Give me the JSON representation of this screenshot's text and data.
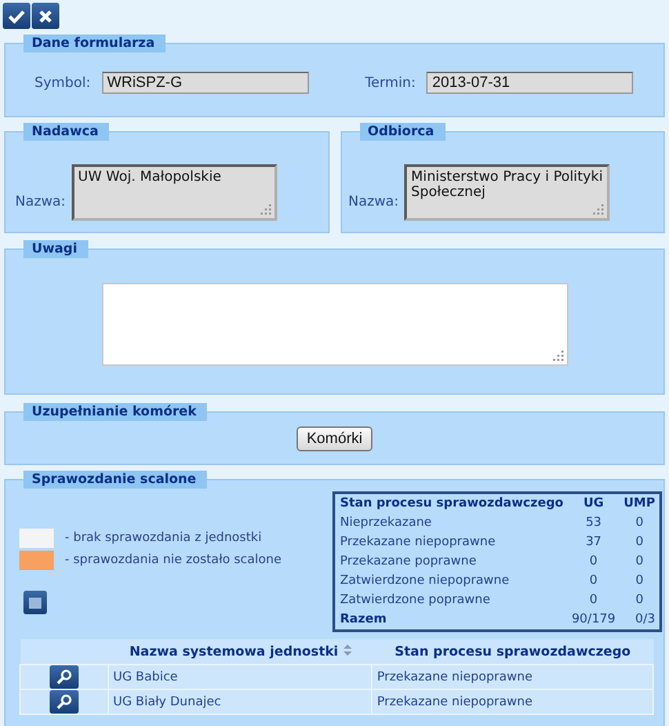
{
  "toolbar": {
    "buttons": [
      {
        "kind": "confirm"
      },
      {
        "kind": "cancel"
      }
    ]
  },
  "form_data": {
    "legend": "Dane formularza",
    "symbol_label": "Symbol:",
    "symbol_value": "WRiSPZ-G",
    "deadline_label": "Termin:",
    "deadline_value": "2013-07-31"
  },
  "sender": {
    "legend": "Nadawca",
    "name_label": "Nazwa:",
    "name_value": "UW Woj. Małopolskie"
  },
  "recipient": {
    "legend": "Odbiorca",
    "name_label": "Nazwa:",
    "name_value": "Ministerstwo Pracy i Polityki Społecznej"
  },
  "remarks": {
    "legend": "Uwagi"
  },
  "cells": {
    "legend": "Uzupełnianie komórek",
    "button": "Komórki"
  },
  "merged_report": {
    "legend": "Sprawozdanie scalone",
    "legend_items": [
      {
        "color": "#f4f4f4",
        "label": "- brak sprawozdania z jednostki"
      },
      {
        "color": "#f8a060",
        "label": "- sprawozdania nie zostało scalone"
      }
    ],
    "summary": {
      "columns": [
        "Stan procesu sprawozdawczego",
        "UG",
        "UMP"
      ],
      "rows": [
        [
          "Nieprzekazane",
          "53",
          "0"
        ],
        [
          "Przekazane niepoprawne",
          "37",
          "0"
        ],
        [
          "Przekazane poprawne",
          "0",
          "0"
        ],
        [
          "Zatwierdzone niepoprawne",
          "0",
          "0"
        ],
        [
          "Zatwierdzone poprawne",
          "0",
          "0"
        ]
      ],
      "total": [
        "Razem",
        "90/179",
        "0/3"
      ]
    },
    "table": {
      "columns": [
        "Nazwa systemowa jednostki",
        "Stan procesu sprawozdawczego"
      ],
      "rows": [
        [
          "UG Babice",
          "Przekazane niepoprawne"
        ],
        [
          "UG Biały Dunajec",
          "Przekazane niepoprawne"
        ]
      ]
    }
  }
}
